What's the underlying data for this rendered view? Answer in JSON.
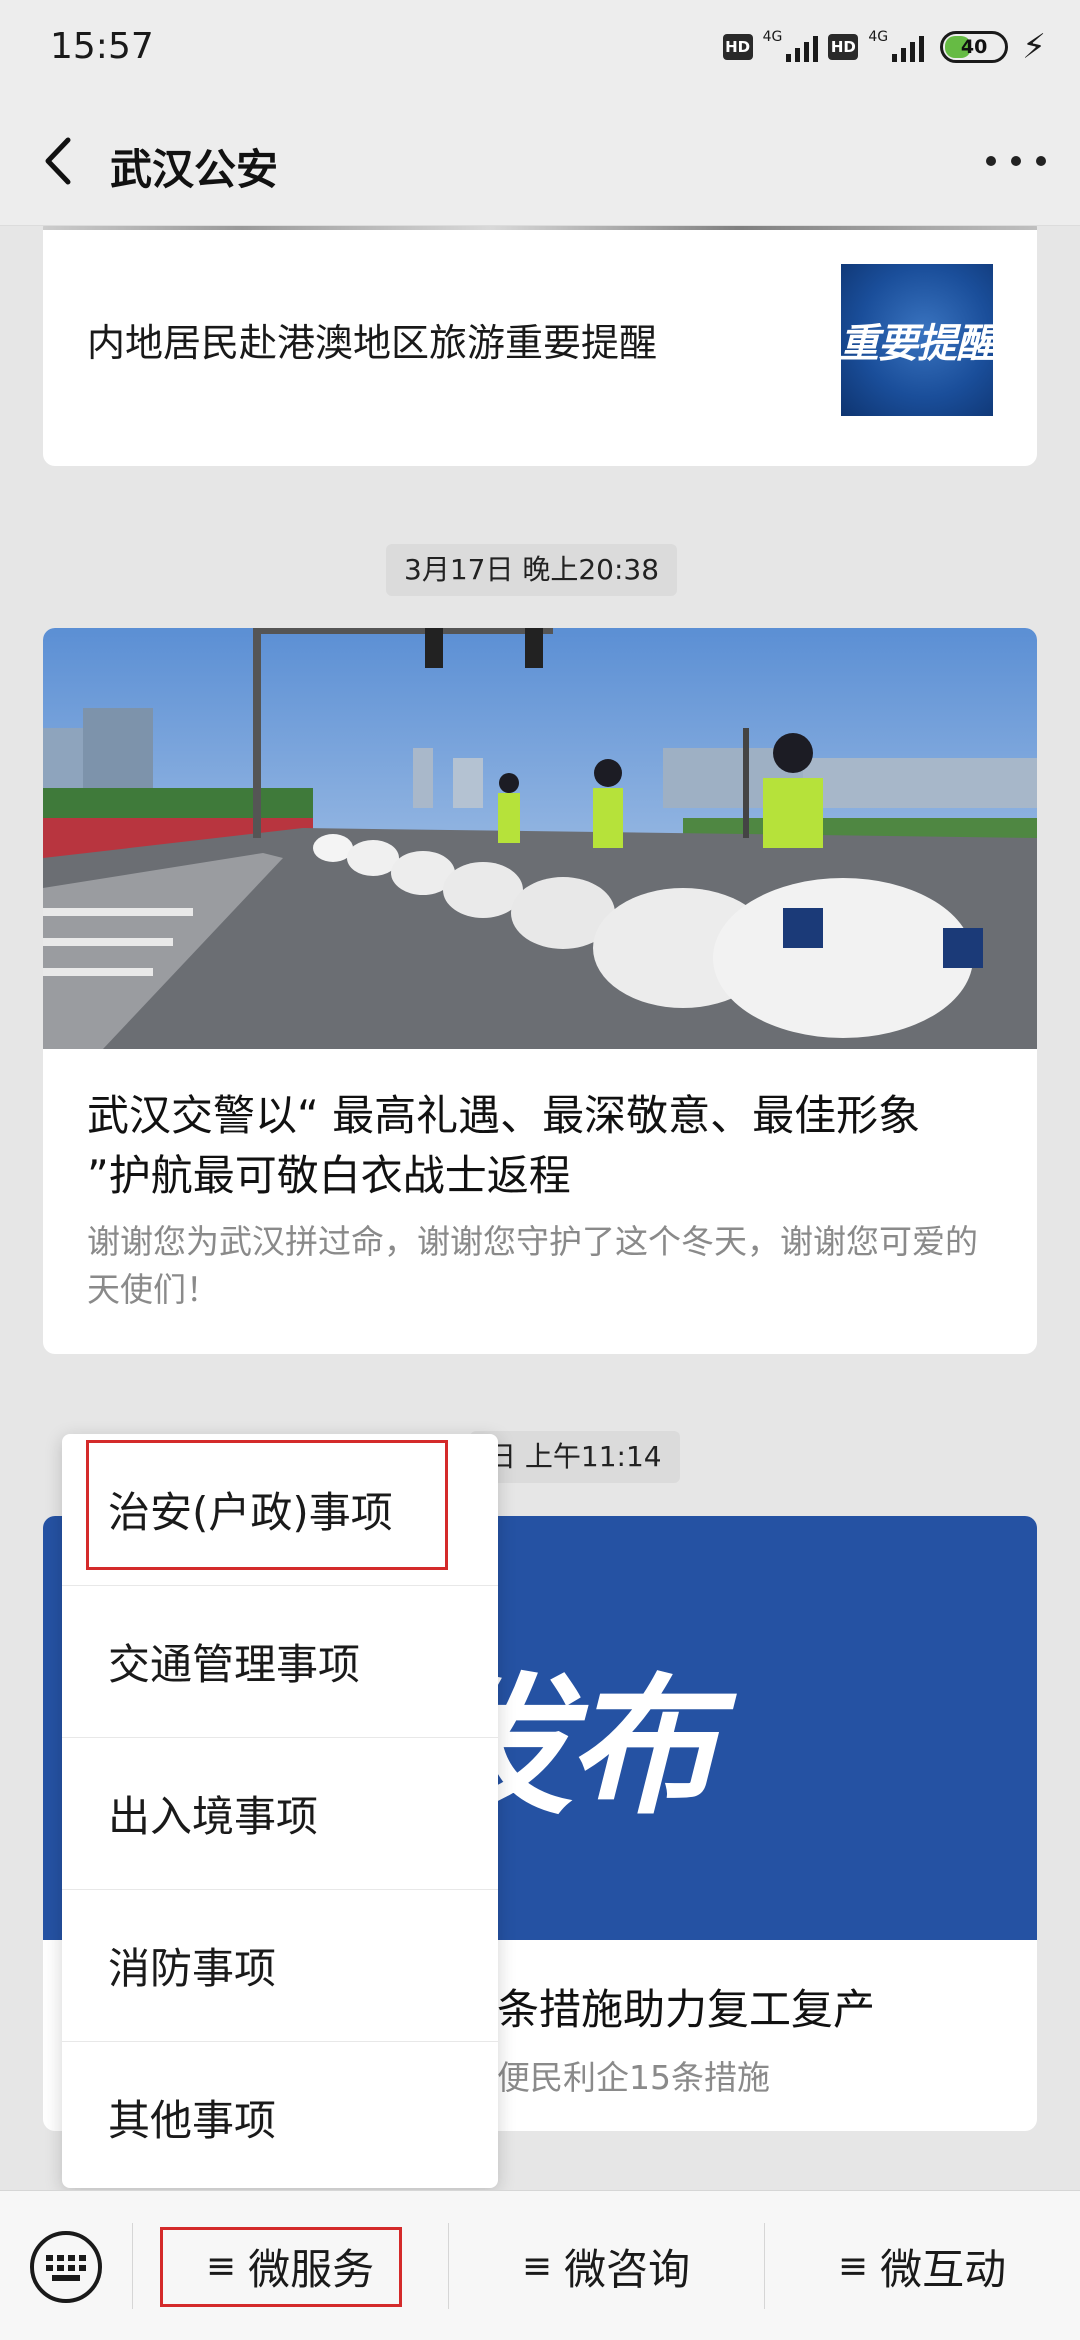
{
  "status_bar": {
    "time": "15:57",
    "hd_label": "HD",
    "network_label": "4G",
    "battery_level": "40",
    "charging_icon": "lightning-bolt-icon"
  },
  "nav": {
    "title": "武汉公安",
    "back_icon": "chevron-left-icon",
    "more_icon": "ellipsis-icon"
  },
  "feed": {
    "card1": {
      "title": "内地居民赴港澳地区旅游重要提醒",
      "thumb_text": "重要提醒"
    },
    "timestamp1": "3月17日 晚上20:38",
    "card2": {
      "title": "武汉交警以“ 最高礼遇、最深敬意、最佳形象 ”护航最可敬白衣战士返程",
      "digest": "谢谢您为武汉拼过命，谢谢您守护了这个冬天，谢谢您可爱的天使们！"
    },
    "timestamp2": "日 上午11:14",
    "card3": {
      "banner_text": "发布",
      "title": "条措施助力复工复产",
      "digest": "便民利企15条措施"
    }
  },
  "popup_menu": {
    "items": [
      {
        "label": "治安(户政)事项"
      },
      {
        "label": "交通管理事项"
      },
      {
        "label": "出入境事项"
      },
      {
        "label": "消防事项"
      },
      {
        "label": "其他事项"
      }
    ]
  },
  "menu_bar": {
    "keyboard_icon": "keyboard-icon",
    "hamburger_icon": "≡",
    "buttons": [
      {
        "label": "微服务"
      },
      {
        "label": "微咨询"
      },
      {
        "label": "微互动"
      }
    ]
  },
  "colors": {
    "highlight_box": "#d42a2a",
    "banner_blue": "#2552a3",
    "background": "#e6e6e6"
  }
}
